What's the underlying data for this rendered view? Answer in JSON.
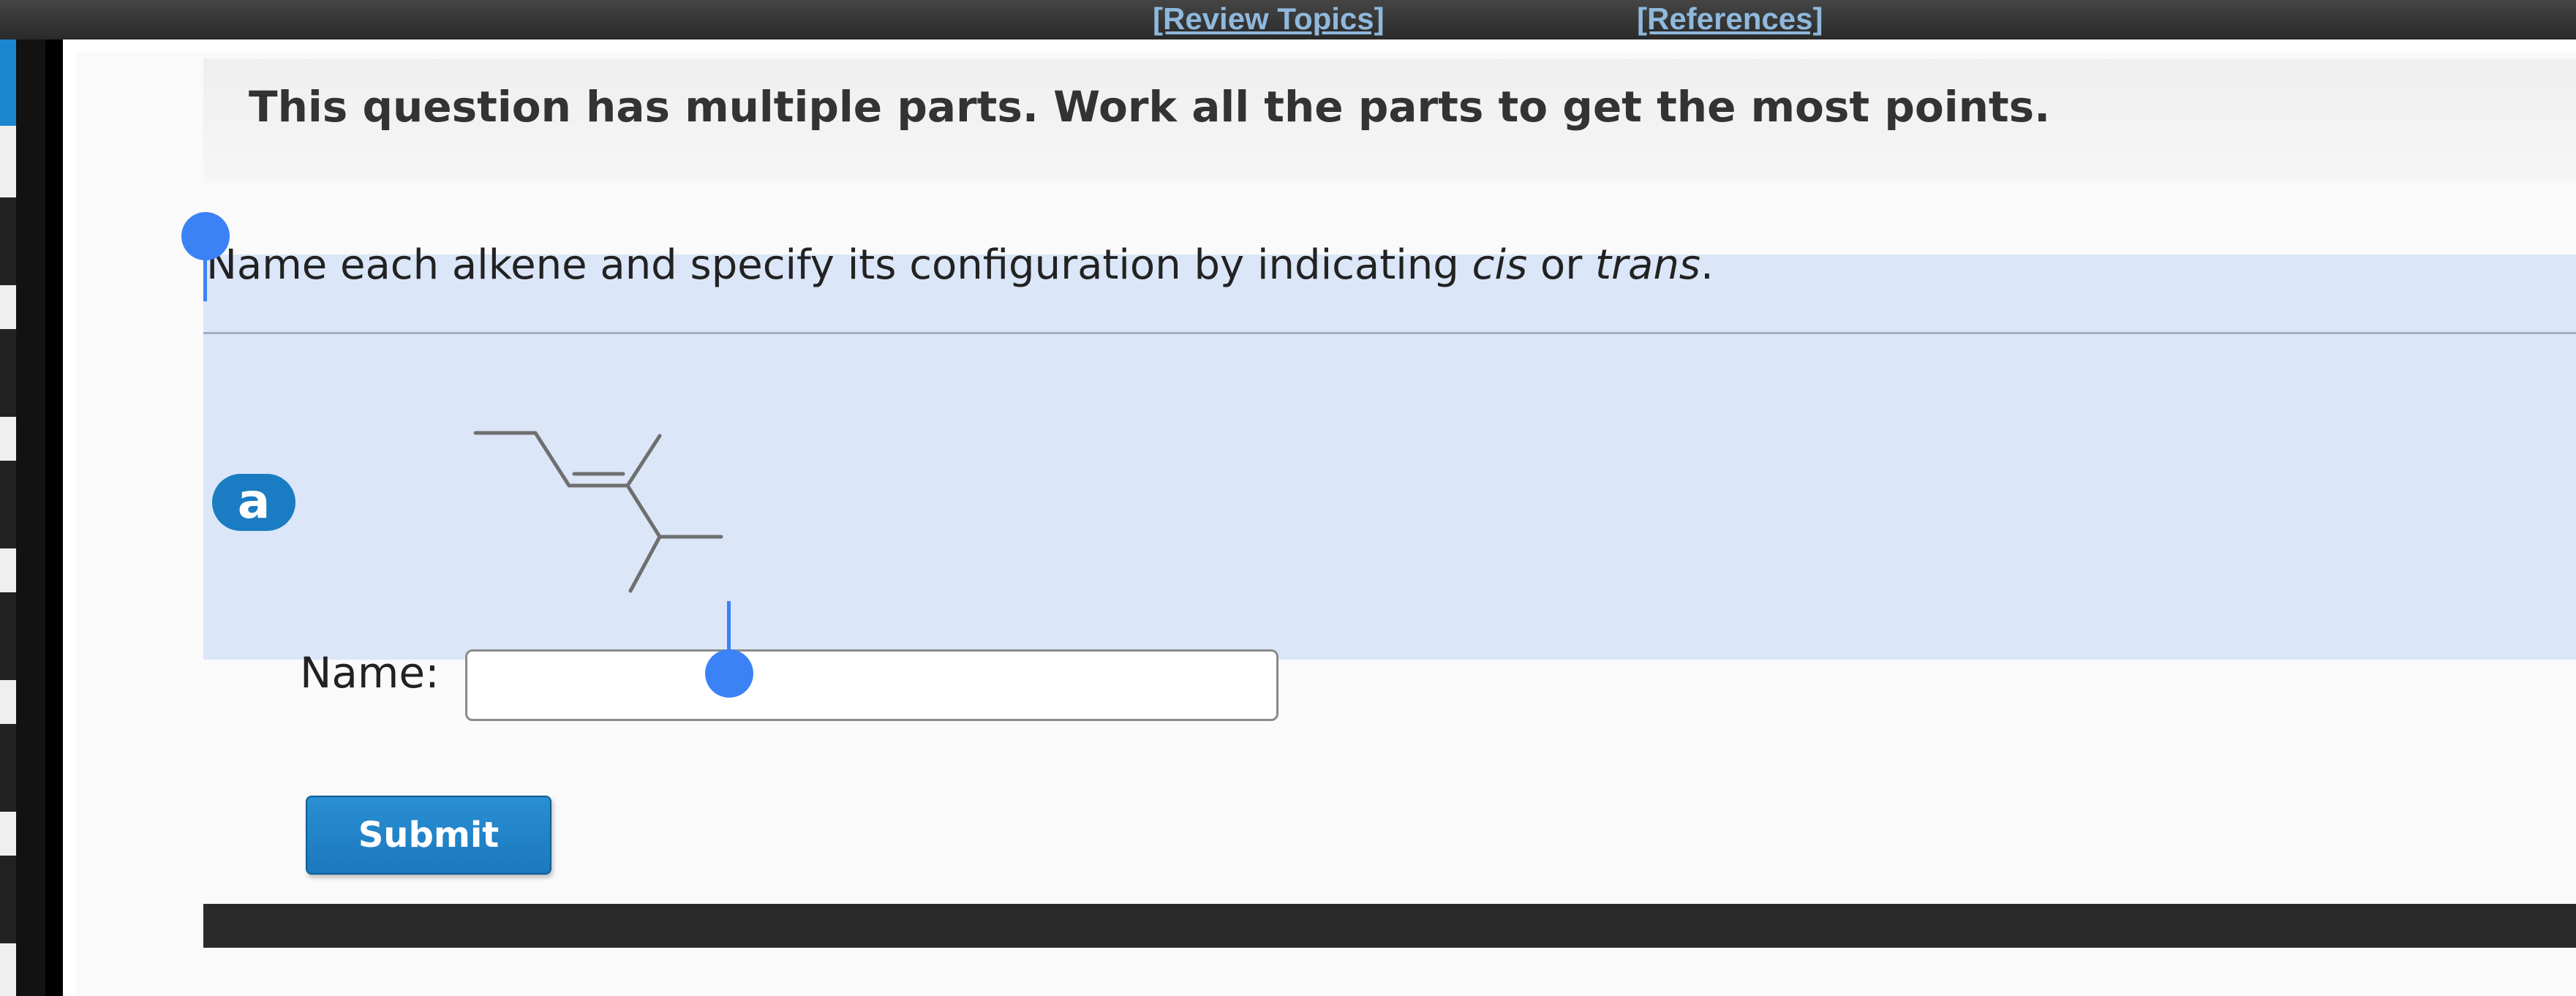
{
  "toolbar": {
    "review_topics_link": "[Review Topics]",
    "references_link": "[References]"
  },
  "question": {
    "header": "This question has multiple parts. Work all the parts to get the most points.",
    "instruction_prefix": "Name each alkene and specify its configuration by indicating ",
    "instruction_cis": "cis",
    "instruction_or": " or ",
    "instruction_trans": "trans",
    "instruction_suffix": "."
  },
  "part": {
    "badge": "a",
    "structure_icon": "alkene-skeletal-structure",
    "name_label": "Name:",
    "name_value": "",
    "name_placeholder": ""
  },
  "actions": {
    "submit_label": "Submit"
  },
  "colors": {
    "accent_blue": "#1a7cc2",
    "selection_blue": "#3b82f6",
    "highlight_background": "#dbe6f8",
    "link_color": "#8fb8dc"
  }
}
